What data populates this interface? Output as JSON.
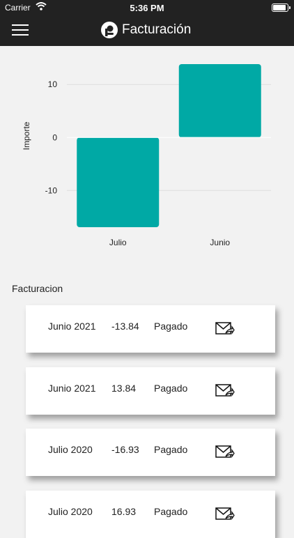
{
  "status_bar": {
    "carrier": "Carrier",
    "time": "5:36 PM"
  },
  "header": {
    "title": "Facturación"
  },
  "chart_data": {
    "type": "bar",
    "categories": [
      "Julio",
      "Junio"
    ],
    "values": [
      -16.93,
      13.84
    ],
    "ylabel": "Importe",
    "ylim": [
      -16.93,
      13.84
    ],
    "yticks": [
      10,
      0,
      -10
    ],
    "color": "#00a9a5"
  },
  "section_title": "Facturacion",
  "invoices": [
    {
      "period": "Junio 2021",
      "amount": "-13.84",
      "status": "Pagado"
    },
    {
      "period": "Junio 2021",
      "amount": "13.84",
      "status": "Pagado"
    },
    {
      "period": "Julio 2020",
      "amount": "-16.93",
      "status": "Pagado"
    },
    {
      "period": "Julio 2020",
      "amount": "16.93",
      "status": "Pagado"
    }
  ]
}
